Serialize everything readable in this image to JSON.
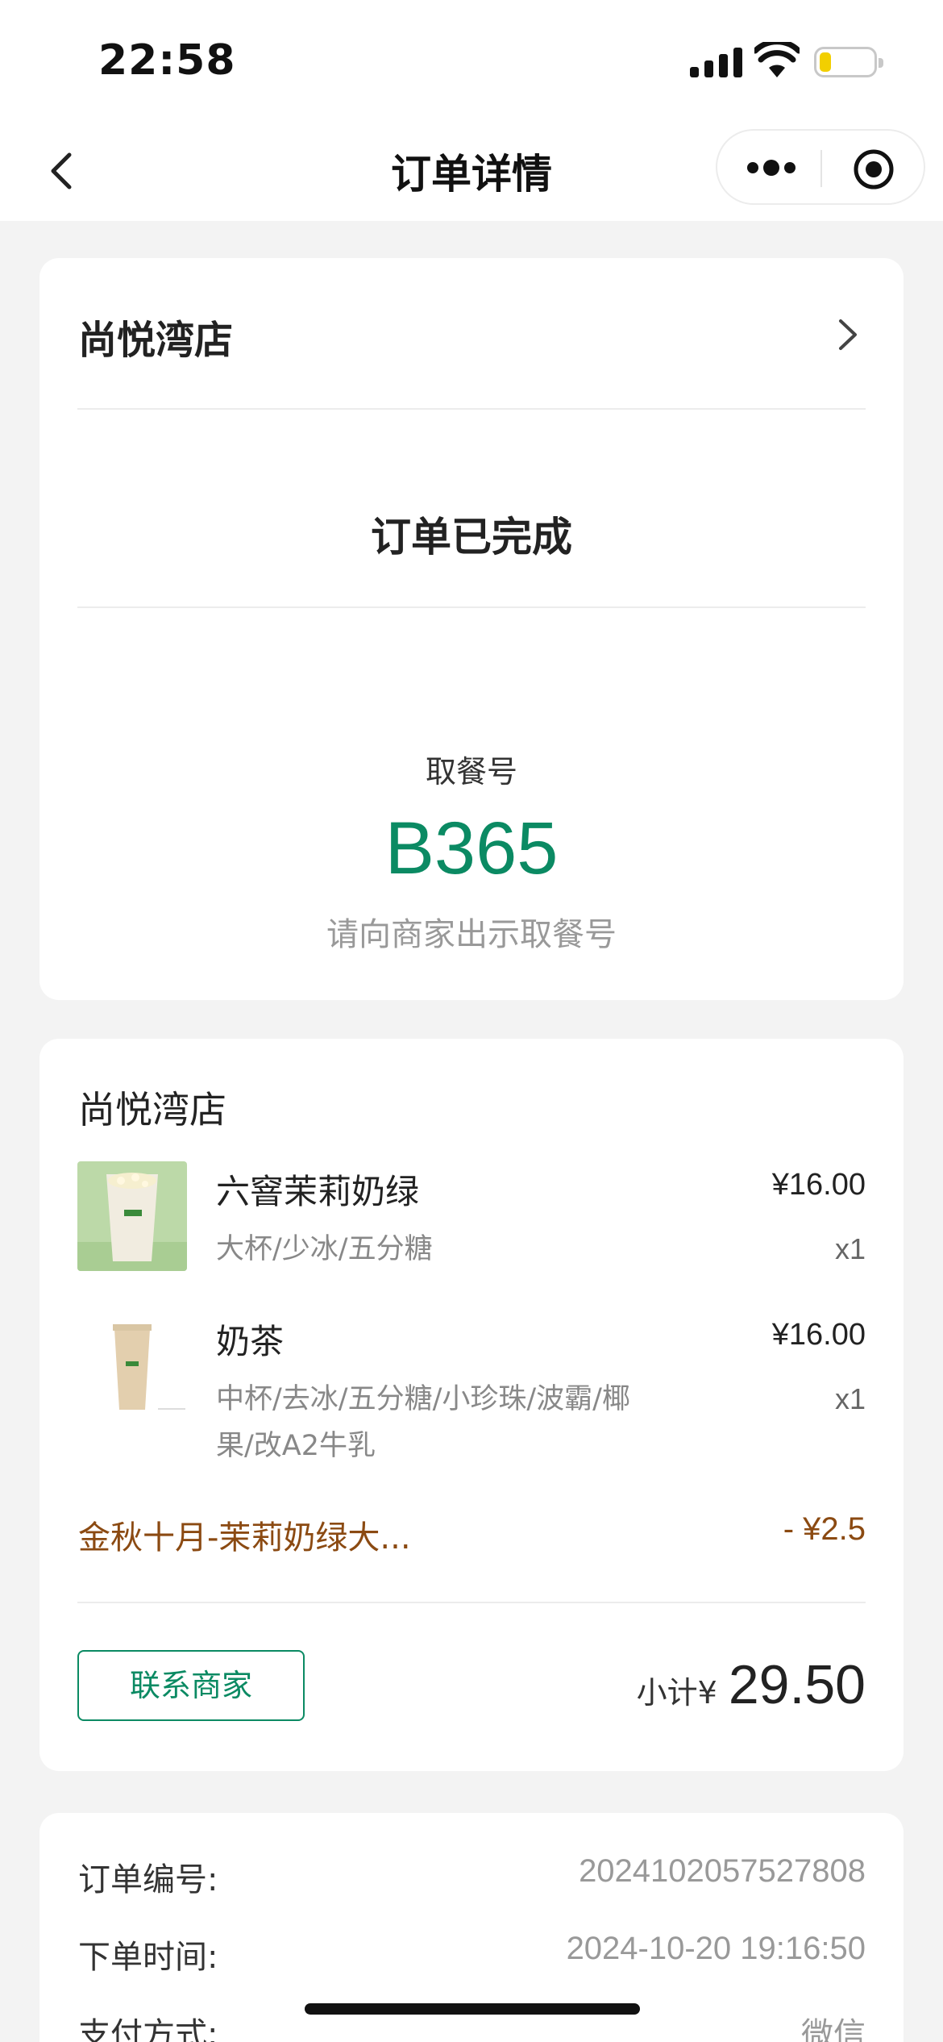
{
  "status_bar": {
    "time": "22:58",
    "battery_color": "#f2cf00"
  },
  "nav": {
    "title": "订单详情",
    "back_icon": "chevron-left-icon",
    "more_icon": "more-dots-icon",
    "close_icon": "target-close-icon"
  },
  "store": {
    "name": "尚悦湾店"
  },
  "order": {
    "status": "订单已完成",
    "pickup_label": "取餐号",
    "pickup_number": "B365",
    "pickup_hint": "请向商家出示取餐号",
    "accent_color": "#0b8a63"
  },
  "items_card": {
    "store_name": "尚悦湾店",
    "items": [
      {
        "name": "六窨茉莉奶绿",
        "spec": "大杯/少冰/五分糖",
        "price": "¥16.00",
        "qty": "x1"
      },
      {
        "name": "奶茶",
        "spec": "中杯/去冰/五分糖/小珍珠/波霸/椰果/改A2牛乳",
        "price": "¥16.00",
        "qty": "x1"
      }
    ],
    "promo": {
      "label": "金秋十月-茉莉奶绿大...",
      "amount": "- ¥2.5"
    },
    "contact_button": "联系商家",
    "subtotal_label": "小计¥",
    "subtotal_amount": "29.50"
  },
  "info": {
    "rows": [
      {
        "label": "订单编号:",
        "value": "2024102057527808"
      },
      {
        "label": "下单时间:",
        "value": "2024-10-20 19:16:50"
      },
      {
        "label": "支付方式:",
        "value": "微信"
      }
    ]
  }
}
